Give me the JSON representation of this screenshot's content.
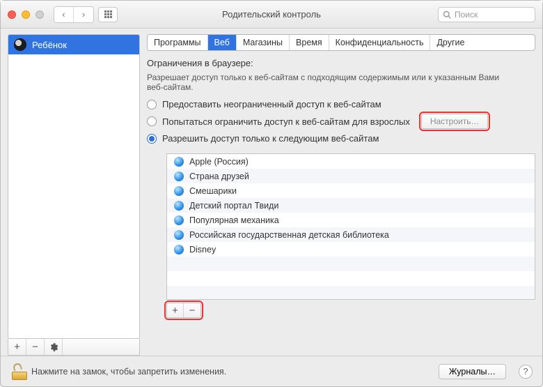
{
  "window": {
    "title": "Родительский контроль"
  },
  "search": {
    "placeholder": "Поиск"
  },
  "sidebar": {
    "users": [
      {
        "name": "Ребёнок"
      }
    ],
    "add_label": "+",
    "remove_label": "−",
    "settings_label": "✱"
  },
  "tabs": [
    {
      "label": "Программы",
      "active": false
    },
    {
      "label": "Веб",
      "active": true
    },
    {
      "label": "Магазины",
      "active": false
    },
    {
      "label": "Время",
      "active": false
    },
    {
      "label": "Конфиденциальность",
      "active": false
    },
    {
      "label": "Другие",
      "active": false
    }
  ],
  "section": {
    "title": "Ограничения в браузере:",
    "desc": "Разрешает доступ только к веб-сайтам с подходящим содержимым или к указанным Вами веб-сайтам."
  },
  "radios": {
    "opt1": "Предоставить неограниченный доступ к веб-сайтам",
    "opt2": "Попытаться ограничить доступ к веб-сайтам для взрослых",
    "opt3": "Разрешить доступ только к следующим веб-сайтам",
    "selected": 3,
    "configure_label": "Настроить…"
  },
  "sites": [
    "Apple (Россия)",
    "Страна друзей",
    "Смешарики",
    "Детский портал Твиди",
    "Популярная механика",
    "Российская государственная детская библиотека",
    "Disney"
  ],
  "list_toolbar": {
    "add": "+",
    "remove": "−"
  },
  "footer": {
    "lock_text": "Нажмите на замок, чтобы запретить изменения.",
    "journals": "Журналы…",
    "help": "?"
  }
}
